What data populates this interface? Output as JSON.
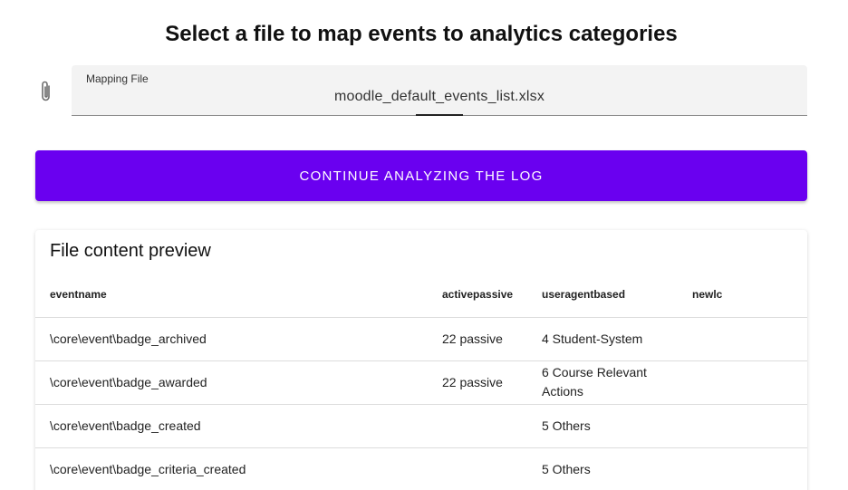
{
  "page": {
    "title": "Select a file to map events to analytics categories"
  },
  "file_input": {
    "icon": "paperclip-icon",
    "label": "Mapping File",
    "value": "moodle_default_events_list.xlsx"
  },
  "actions": {
    "continue_label": "Continue analyzing the log",
    "continue_color": "#6a00f0"
  },
  "preview": {
    "title": "File content preview",
    "columns": [
      "eventname",
      "activepassive",
      "useragentbased",
      "newlc"
    ],
    "rows": [
      [
        "\\core\\event\\badge_archived",
        "22 passive",
        "4 Student-System",
        ""
      ],
      [
        "\\core\\event\\badge_awarded",
        "22 passive",
        "6 Course Relevant Actions",
        ""
      ],
      [
        "\\core\\event\\badge_created",
        "",
        "5 Others",
        ""
      ],
      [
        "\\core\\event\\badge_criteria_created",
        "",
        "5 Others",
        ""
      ]
    ]
  }
}
